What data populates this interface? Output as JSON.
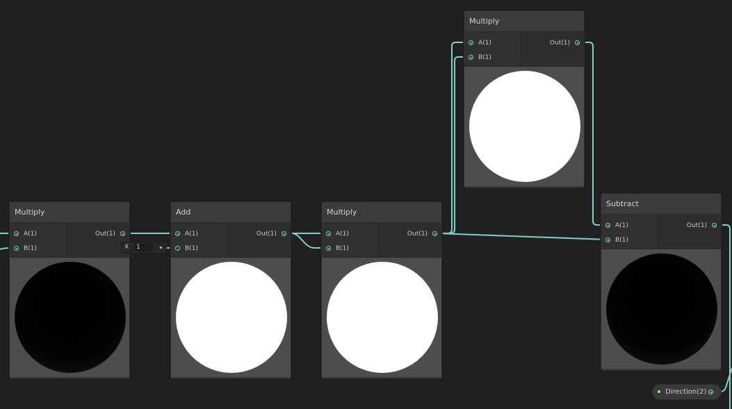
{
  "graph": {
    "wire_color": "#7fd1cc",
    "vector_port_color": "#9fe39a",
    "background": "#202020",
    "nodes": [
      {
        "title": "Multiply",
        "inputs": [
          "A(1)",
          "B(1)"
        ],
        "output": "Out(1)",
        "preview": "black"
      },
      {
        "title": "Add",
        "inputs": [
          "A(1)",
          "B(1)"
        ],
        "output": "Out(1)",
        "preview": "white"
      },
      {
        "title": "Multiply",
        "inputs": [
          "A(1)",
          "B(1)"
        ],
        "output": "Out(1)",
        "preview": "white"
      },
      {
        "title": "Multiply",
        "inputs": [
          "A(1)",
          "B(1)"
        ],
        "output": "Out(1)",
        "preview": "white"
      },
      {
        "title": "Subtract",
        "inputs": [
          "A(1)",
          "B(1)"
        ],
        "output": "Out(1)",
        "preview": "black"
      }
    ],
    "inline_input": {
      "label": "X",
      "value": "1"
    },
    "property_pill": {
      "label": "Direction(2)"
    }
  }
}
